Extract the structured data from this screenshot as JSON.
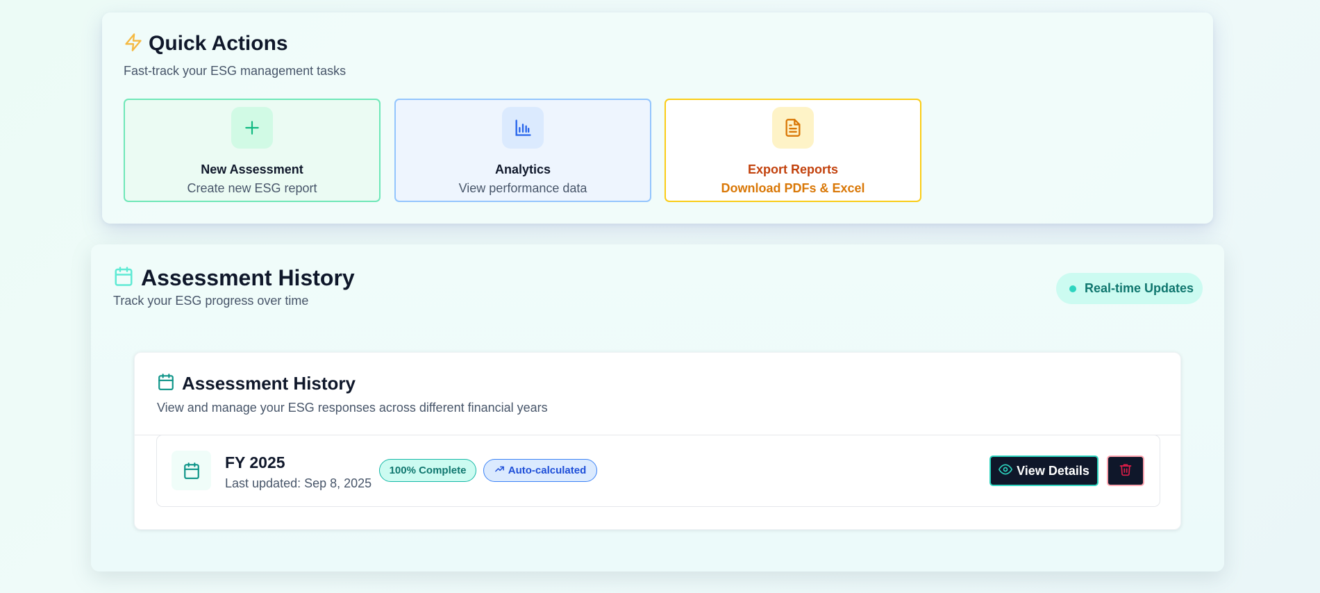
{
  "quick_actions": {
    "title": "Quick Actions",
    "subtitle": "Fast-track your ESG management tasks",
    "title_icon": "lightning-icon",
    "actions": [
      {
        "title": "New Assessment",
        "subtitle": "Create new ESG report",
        "icon": "plus-icon",
        "color": "#10b981"
      },
      {
        "title": "Analytics",
        "subtitle": "View performance data",
        "icon": "bar-chart-icon",
        "color": "#2563eb"
      },
      {
        "title": "Export Reports",
        "subtitle": "Download PDFs & Excel",
        "icon": "document-icon",
        "color": "#d97706"
      }
    ]
  },
  "history_section": {
    "title": "Assessment History",
    "subtitle": "Track your ESG progress over time",
    "title_icon": "calendar-icon",
    "status_pill": "Real-time Updates"
  },
  "history_panel": {
    "title": "Assessment History",
    "subtitle": "View and manage your ESG responses across different financial years",
    "title_icon": "calendar-icon",
    "entries": [
      {
        "year": "FY 2025",
        "updated": "Last updated: Sep 8, 2025",
        "badge_complete": "100% Complete",
        "badge_auto": "Auto-calculated",
        "view_label": "View Details"
      }
    ]
  },
  "colors": {
    "accent_teal": "#14b8a6",
    "dark": "#0f172a",
    "danger": "#e11d48"
  }
}
